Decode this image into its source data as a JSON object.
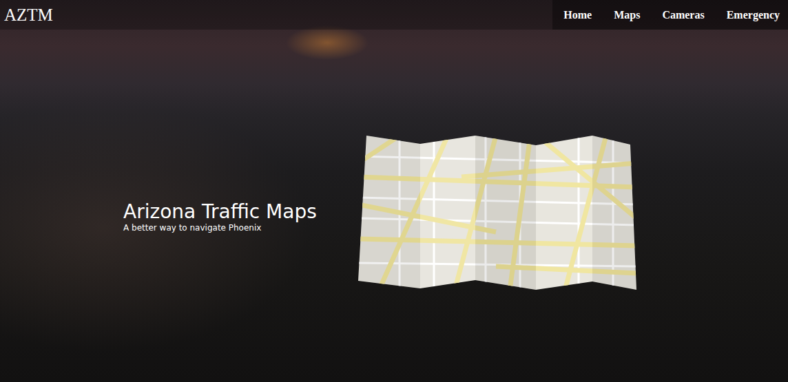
{
  "header": {
    "logo": "AZTM"
  },
  "nav": [
    {
      "label": "Home"
    },
    {
      "label": "Maps"
    },
    {
      "label": "Cameras"
    },
    {
      "label": "Emergency"
    }
  ],
  "hero": {
    "title": "Arizona Traffic Maps",
    "subtitle": "A better way to navigate Phoenix"
  }
}
